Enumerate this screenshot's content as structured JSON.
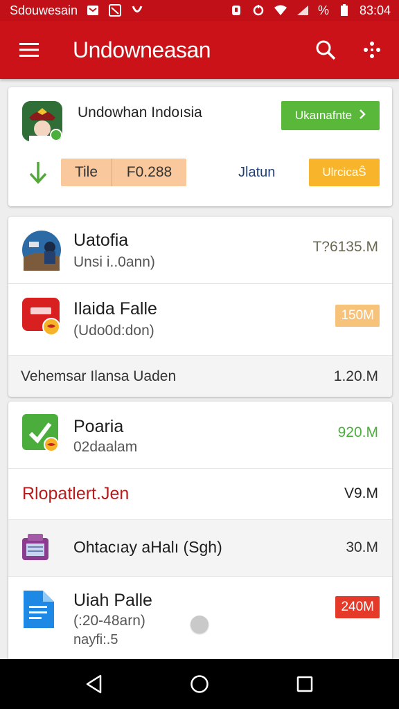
{
  "status_bar": {
    "carrier": "Sdouwesain",
    "battery_percent": "%",
    "time": "83:04"
  },
  "app_bar": {
    "title": "Undowneasan"
  },
  "hero": {
    "title": "Undowhan Indoısia",
    "primary_button": "Ukaınafnte",
    "pill_label": "Tile",
    "pill_value": "F0.288",
    "link_text": "Jlatun",
    "secondary_button": "UlrcicaŜ"
  },
  "card2": {
    "items": [
      {
        "title": "Uatofia",
        "subtitle": "Unsi i..0ann)",
        "size": "T?6135.M"
      },
      {
        "title": "Ilaida Falle",
        "subtitle": "(Udo0d:don)",
        "size": "150M",
        "tag_color": "#f7c27a"
      },
      {
        "title": "Vehemsar Ilansa Uaden",
        "size": "1.20.M"
      }
    ]
  },
  "card3": {
    "items": [
      {
        "title": "Poaria",
        "subtitle": "02daalam",
        "size": "920.M",
        "size_color": "#4caf3c"
      },
      {
        "title": "Rlopatlert.Jen",
        "size": "V9.M",
        "title_color": "#b71c1c"
      },
      {
        "title": "Ohtacıay aHalı (Sgh)",
        "size": "30.M"
      },
      {
        "title": "Uiah Palle",
        "subtitle": "(:20-48arn)",
        "note": "nayfi:.5",
        "size": "240M",
        "tag_color": "#e53a2a"
      }
    ]
  },
  "colors": {
    "brand": "#cc1219",
    "green": "#59b839",
    "yellow": "#f8b52c"
  },
  "icons": [
    "menu-icon",
    "search-icon",
    "more-icon",
    "check-badge-icon",
    "download-arrow-icon",
    "chevron-right-icon",
    "back-icon",
    "home-icon",
    "recents-icon"
  ]
}
